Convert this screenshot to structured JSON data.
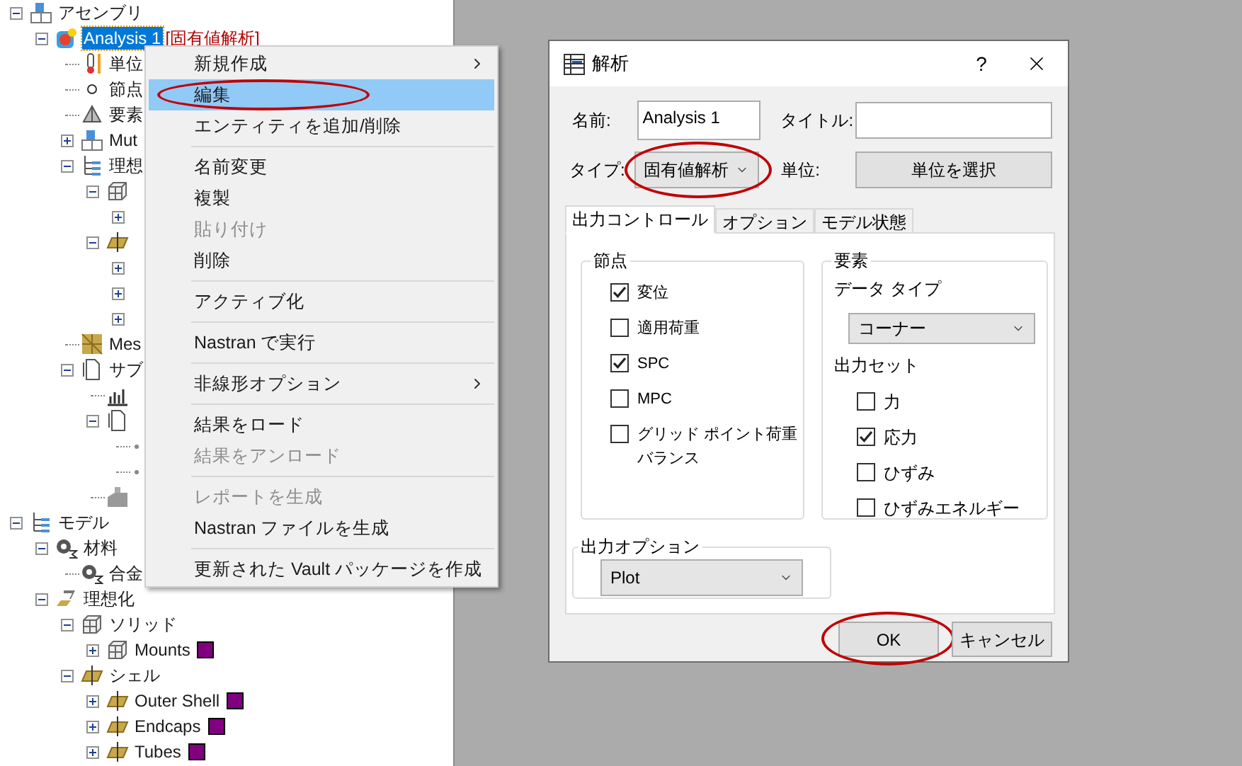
{
  "tree": [
    {
      "kind": "assembly",
      "label": "アセンブリ",
      "expanded": true,
      "selected": false,
      "children": [
        {
          "kind": "analysis",
          "label": "Analysis 1",
          "tag": "[固有値解析]",
          "expanded": true,
          "selected": true,
          "children": [
            {
              "kind": "thermometer",
              "label": "単位",
              "selected": false
            },
            {
              "kind": "node",
              "label": "節点",
              "selected": false
            },
            {
              "kind": "element",
              "label": "要素",
              "selected": false
            },
            {
              "kind": "assembly",
              "label": "Mut",
              "expanded": false,
              "selected": false
            },
            {
              "kind": "hierarchy",
              "label": "理想",
              "expanded": true,
              "selected": false,
              "children": [
                {
                  "kind": "solid",
                  "expanded": true,
                  "children": [
                    {
                      "expanded": false
                    }
                  ]
                },
                {
                  "kind": "shell",
                  "expanded": true,
                  "children": [
                    {
                      "expanded": false
                    },
                    {
                      "expanded": false
                    },
                    {
                      "expanded": false
                    }
                  ]
                }
              ]
            },
            {
              "kind": "mesh",
              "label": "Mes",
              "selected": false
            },
            {
              "kind": "document",
              "label": "サブ",
              "expanded": true,
              "selected": false,
              "children": [
                {
                  "kind": "chart"
                },
                {
                  "kind": "document",
                  "expanded": true,
                  "children": [
                    {
                      "kind": "stub"
                    },
                    {
                      "kind": "stub"
                    }
                  ]
                },
                {
                  "kind": "part"
                }
              ]
            }
          ]
        }
      ]
    },
    {
      "kind": "hierarchy",
      "label": "モデル",
      "expanded": true,
      "selected": false,
      "children": [
        {
          "kind": "material",
          "label": "材料",
          "expanded": true,
          "selected": false,
          "children": [
            {
              "kind": "material",
              "label": "合金",
              "selected": false
            }
          ]
        },
        {
          "kind": "idealization",
          "label": "理想化",
          "expanded": true,
          "selected": false,
          "children": [
            {
              "kind": "solid",
              "label": "ソリッド",
              "expanded": true,
              "selected": false,
              "children": [
                {
                  "kind": "solid",
                  "label": "Mounts",
                  "expanded": false,
                  "selected": false,
                  "color": "#800080"
                }
              ]
            },
            {
              "kind": "shell",
              "label": "シェル",
              "expanded": true,
              "selected": false,
              "children": [
                {
                  "kind": "shell",
                  "label": "Outer Shell",
                  "expanded": false,
                  "selected": false,
                  "color": "#800080"
                },
                {
                  "kind": "shell",
                  "label": "Endcaps",
                  "expanded": false,
                  "selected": false,
                  "color": "#800080"
                },
                {
                  "kind": "shell",
                  "label": "Tubes",
                  "expanded": false,
                  "selected": false,
                  "color": "#800080"
                }
              ]
            }
          ]
        }
      ]
    }
  ],
  "context_menu": {
    "items": [
      {
        "kind": "item",
        "label": "新規作成",
        "submenu": true,
        "disabled": false,
        "selected": false,
        "circled": false
      },
      {
        "kind": "item",
        "label": "編集",
        "submenu": false,
        "disabled": false,
        "selected": true,
        "circled": true
      },
      {
        "kind": "item",
        "label": "エンティティを追加/削除",
        "submenu": false,
        "disabled": false,
        "selected": false,
        "circled": false
      },
      {
        "kind": "separator"
      },
      {
        "kind": "item",
        "label": "名前変更",
        "submenu": false,
        "disabled": false,
        "selected": false,
        "circled": false
      },
      {
        "kind": "item",
        "label": "複製",
        "submenu": false,
        "disabled": false,
        "selected": false,
        "circled": false
      },
      {
        "kind": "item",
        "label": "貼り付け",
        "submenu": false,
        "disabled": true,
        "selected": false,
        "circled": false
      },
      {
        "kind": "item",
        "label": "削除",
        "submenu": false,
        "disabled": false,
        "selected": false,
        "circled": false
      },
      {
        "kind": "separator"
      },
      {
        "kind": "item",
        "label": "アクティブ化",
        "submenu": false,
        "disabled": false,
        "selected": false,
        "circled": false
      },
      {
        "kind": "separator"
      },
      {
        "kind": "item",
        "label": "Nastran で実行",
        "submenu": false,
        "disabled": false,
        "selected": false,
        "circled": false
      },
      {
        "kind": "separator"
      },
      {
        "kind": "item",
        "label": "非線形オプション",
        "submenu": true,
        "disabled": false,
        "selected": false,
        "circled": false
      },
      {
        "kind": "separator"
      },
      {
        "kind": "item",
        "label": "結果をロード",
        "submenu": false,
        "disabled": false,
        "selected": false,
        "circled": false
      },
      {
        "kind": "item",
        "label": "結果をアンロード",
        "submenu": false,
        "disabled": true,
        "selected": false,
        "circled": false
      },
      {
        "kind": "separator"
      },
      {
        "kind": "item",
        "label": "レポートを生成",
        "submenu": false,
        "disabled": true,
        "selected": false,
        "circled": false
      },
      {
        "kind": "item",
        "label": "Nastran ファイルを生成",
        "submenu": false,
        "disabled": false,
        "selected": false,
        "circled": false
      },
      {
        "kind": "separator"
      },
      {
        "kind": "item",
        "label": "更新された Vault パッケージを作成",
        "submenu": false,
        "disabled": false,
        "selected": false,
        "circled": false
      }
    ]
  },
  "dialog": {
    "title": "解析",
    "help": "?",
    "name": {
      "label": "名前:",
      "value": "Analysis 1"
    },
    "title_field": {
      "label": "タイトル:"
    },
    "type": {
      "label": "タイプ:",
      "value": "固有値解析",
      "circled": true
    },
    "unit": {
      "label": "単位:",
      "button": "単位を選択"
    },
    "tabs": [
      {
        "label": "出力コントロール",
        "selected": true
      },
      {
        "label": "オプション",
        "selected": false
      },
      {
        "label": "モデル状態",
        "selected": false
      }
    ],
    "nodes": {
      "title": "節点",
      "options": [
        {
          "label": "変位",
          "checked": true
        },
        {
          "label": "適用荷重",
          "checked": false
        },
        {
          "label": "SPC",
          "checked": true
        },
        {
          "label": "MPC",
          "checked": false
        },
        {
          "label": "グリッド ポイント荷重バランス",
          "checked": false
        }
      ]
    },
    "elements": {
      "title": "要素",
      "data_type_label": "データ タイプ",
      "data_type": "コーナー",
      "output_set_label": "出力セット",
      "options": [
        {
          "label": "力",
          "checked": false
        },
        {
          "label": "応力",
          "checked": true
        },
        {
          "label": "ひずみ",
          "checked": false
        },
        {
          "label": "ひずみエネルギー",
          "checked": false
        }
      ]
    },
    "output_options": {
      "title": "出力オプション",
      "value": "Plot"
    },
    "buttons": [
      {
        "label": "OK",
        "circled": true
      },
      {
        "label": "キャンセル",
        "circled": false
      }
    ]
  }
}
